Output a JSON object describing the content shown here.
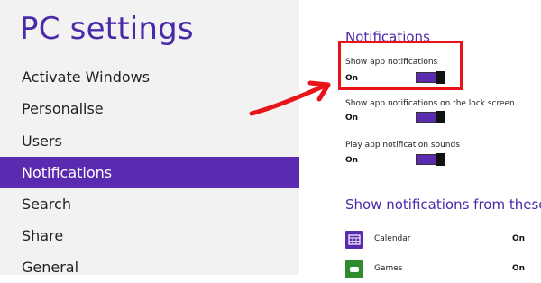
{
  "app": {
    "title": "PC settings"
  },
  "sidebar": {
    "items": [
      {
        "label": "Activate Windows"
      },
      {
        "label": "Personalise"
      },
      {
        "label": "Users"
      },
      {
        "label": "Notifications",
        "selected": true
      },
      {
        "label": "Search"
      },
      {
        "label": "Share"
      },
      {
        "label": "General"
      }
    ]
  },
  "notifications": {
    "section_title": "Notifications",
    "settings": [
      {
        "label": "Show app notifications",
        "state": "On"
      },
      {
        "label": "Show app notifications on the lock screen",
        "state": "On"
      },
      {
        "label": "Play app notification sounds",
        "state": "On"
      }
    ],
    "apps_section_title": "Show notifications from these",
    "apps": [
      {
        "name": "Calendar",
        "state": "On",
        "icon": "calendar-icon"
      },
      {
        "name": "Games",
        "state": "On",
        "icon": "games-icon"
      }
    ]
  },
  "colors": {
    "accent": "#5a2ab0",
    "annotation": "#e8141a",
    "calendar_tile": "#5a2ab0",
    "games_tile": "#2e8b2e"
  }
}
